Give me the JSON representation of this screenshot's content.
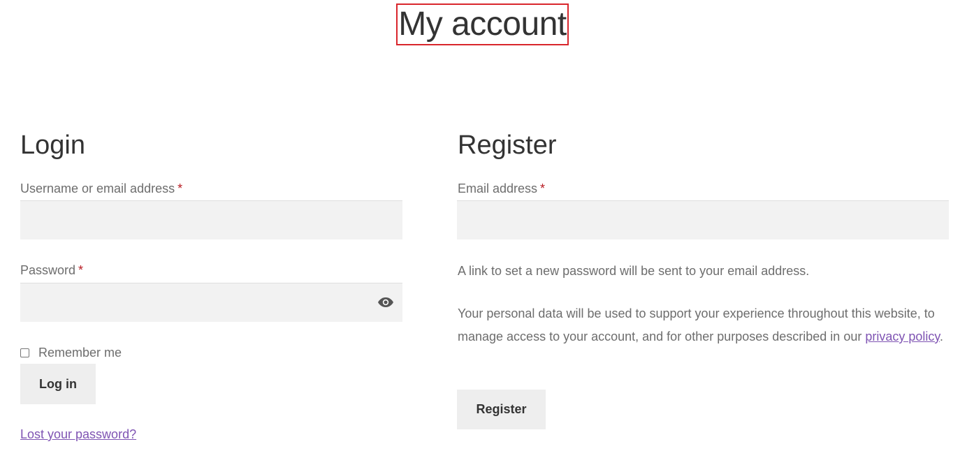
{
  "page": {
    "title": "My account"
  },
  "login": {
    "heading": "Login",
    "username_label": "Username or email address",
    "username_required": "*",
    "username_value": "",
    "password_label": "Password",
    "password_required": "*",
    "password_value": "",
    "show_password_icon": "eye-icon",
    "remember_label": "Remember me",
    "remember_checked": false,
    "submit_label": "Log in",
    "lost_password_link": "Lost your password?"
  },
  "register": {
    "heading": "Register",
    "email_label": "Email address",
    "email_required": "*",
    "email_value": "",
    "info_text": "A link to set a new password will be sent to your email address.",
    "privacy_text_before": "Your personal data will be used to support your experience throughout this website, to manage access to your account, and for other purposes described in our ",
    "privacy_link": "privacy policy",
    "privacy_text_after": ".",
    "submit_label": "Register"
  },
  "colors": {
    "title_highlight_border": "#d9262c",
    "required_marker": "#b81c23",
    "link": "#7f54b3",
    "input_background": "#f2f2f2",
    "button_background": "#eeeeee"
  }
}
